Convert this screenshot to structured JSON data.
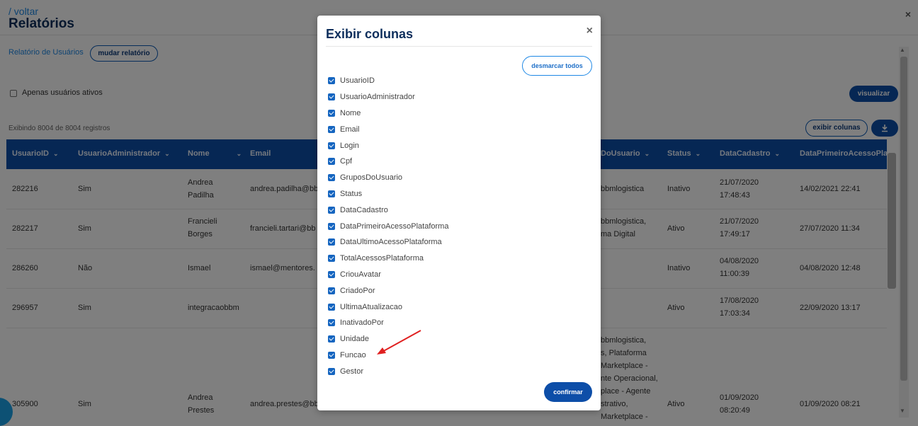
{
  "page": {
    "back_link": "/ voltar",
    "title": "Relatórios",
    "report_name": "Relatório de Usuários",
    "change_report_btn": "mudar relatório",
    "only_active_label": "Apenas usuários ativos",
    "view_btn": "visualizar",
    "records_info": "Exibindo 8004 de 8004 registros",
    "show_columns_btn": "exibir colunas",
    "download_icon": "download-icon",
    "close_icon": "×"
  },
  "table": {
    "headers": [
      "UsuarioID",
      "UsuarioAdministrador",
      "Nome",
      "Email",
      "DoUsuario",
      "Status",
      "DataCadastro",
      "DataPrimeiroAcessoPla"
    ],
    "header_chevron": "⌄",
    "rows": [
      {
        "id": "282216",
        "admin": "Sim",
        "nome1": "Andrea",
        "nome2": "Padilha",
        "email": "andrea.padilha@bb",
        "grupos1": "bbmlogistica",
        "grupos2": "",
        "status": "Inativo",
        "cad1": "21/07/2020",
        "cad2": "17:48:43",
        "primeiro": "14/02/2021 22:41"
      },
      {
        "id": "282217",
        "admin": "Sim",
        "nome1": "Francieli",
        "nome2": "Borges",
        "email": "francieli.tartari@bb",
        "grupos1": "bbmlogistica,",
        "grupos2": "ma Digital",
        "status": "Ativo",
        "cad1": "21/07/2020",
        "cad2": "17:49:17",
        "primeiro": "27/07/2020 11:34"
      },
      {
        "id": "286260",
        "admin": "Não",
        "nome1": "Ismael",
        "nome2": "",
        "email": "ismael@mentores.",
        "grupos1": "",
        "grupos2": "",
        "status": "Inativo",
        "cad1": "04/08/2020",
        "cad2": "11:00:39",
        "primeiro": "04/08/2020 12:48"
      },
      {
        "id": "296957",
        "admin": "Sim",
        "nome1": "integracaobbm",
        "nome2": "",
        "email": "",
        "grupos1": "",
        "grupos2": "",
        "status": "Ativo",
        "cad1": "17/08/2020",
        "cad2": "17:03:34",
        "primeiro": "22/09/2020 13:17"
      },
      {
        "id": "305900",
        "admin": "Sim",
        "nome1": "Andrea",
        "nome2": "Prestes",
        "email": "andrea.prestes@bb",
        "status": "Ativo",
        "cad1": "01/09/2020",
        "cad2": "08:20:49",
        "primeiro": "01/09/2020 08:21",
        "grupos_lines": [
          "bbmlogistica,",
          "s, Plataforma",
          "Marketplace -",
          "nte Operacional,",
          "place - Agente",
          "strativo,",
          "Marketplace -"
        ]
      }
    ]
  },
  "modal": {
    "title": "Exibir colunas",
    "close_icon": "×",
    "uncheck_all_btn": "desmarcar todos",
    "confirm_btn": "confirmar",
    "columns": [
      {
        "label": "UsuarioID",
        "checked": true
      },
      {
        "label": "UsuarioAdministrador",
        "checked": true
      },
      {
        "label": "Nome",
        "checked": true
      },
      {
        "label": "Email",
        "checked": true
      },
      {
        "label": "Login",
        "checked": true
      },
      {
        "label": "Cpf",
        "checked": true
      },
      {
        "label": "GruposDoUsuario",
        "checked": true
      },
      {
        "label": "Status",
        "checked": true
      },
      {
        "label": "DataCadastro",
        "checked": true
      },
      {
        "label": "DataPrimeiroAcessoPlataforma",
        "checked": true
      },
      {
        "label": "DataUltimoAcessoPlataforma",
        "checked": true
      },
      {
        "label": "TotalAcessosPlataforma",
        "checked": true
      },
      {
        "label": "CriouAvatar",
        "checked": true
      },
      {
        "label": "CriadoPor",
        "checked": true
      },
      {
        "label": "UltimaAtualizacao",
        "checked": true
      },
      {
        "label": "InativadoPor",
        "checked": true
      },
      {
        "label": "Unidade",
        "checked": true
      },
      {
        "label": "Funcao",
        "checked": true
      },
      {
        "label": "Gestor",
        "checked": true
      }
    ]
  },
  "colors": {
    "primary": "#0d4ea8",
    "accent": "#1e88e5",
    "annotation_arrow": "#e02020"
  }
}
